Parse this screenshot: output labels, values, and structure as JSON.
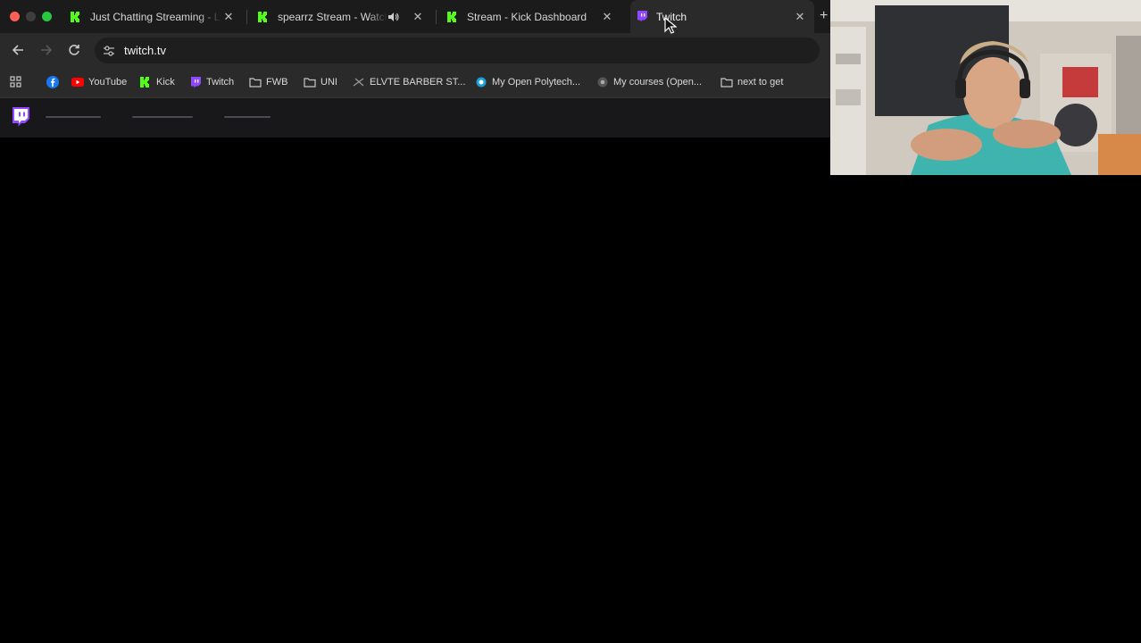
{
  "browser": {
    "tabs": [
      {
        "title": "Just Chatting Streaming - Live",
        "favicon": "kick-icon",
        "active": false
      },
      {
        "title": "spearrz Stream - Watch Live",
        "favicon": "kick-icon",
        "active": false,
        "audio": true
      },
      {
        "title": "Stream - Kick Dashboard",
        "favicon": "kick-icon",
        "active": false
      },
      {
        "title": "Twitch",
        "favicon": "twitch-icon",
        "active": true
      }
    ],
    "address": "twitch.tv",
    "bookmarks": [
      {
        "label": "",
        "icon": "facebook-icon"
      },
      {
        "label": "YouTube",
        "icon": "youtube-icon"
      },
      {
        "label": "Kick",
        "icon": "kick-icon"
      },
      {
        "label": "Twitch",
        "icon": "twitch-icon"
      },
      {
        "label": "FWB",
        "icon": "folder-icon"
      },
      {
        "label": "UNI",
        "icon": "folder-icon"
      },
      {
        "label": "ELVTE BARBER ST...",
        "icon": "scissors-icon"
      },
      {
        "label": "My Open Polytech...",
        "icon": "polytech-icon"
      },
      {
        "label": "My courses (Open...",
        "icon": "moodle-icon"
      },
      {
        "label": "next to get",
        "icon": "folder-icon"
      }
    ]
  },
  "colors": {
    "kick": "#53fc18",
    "twitch": "#9146ff",
    "page_background": "#000000"
  }
}
